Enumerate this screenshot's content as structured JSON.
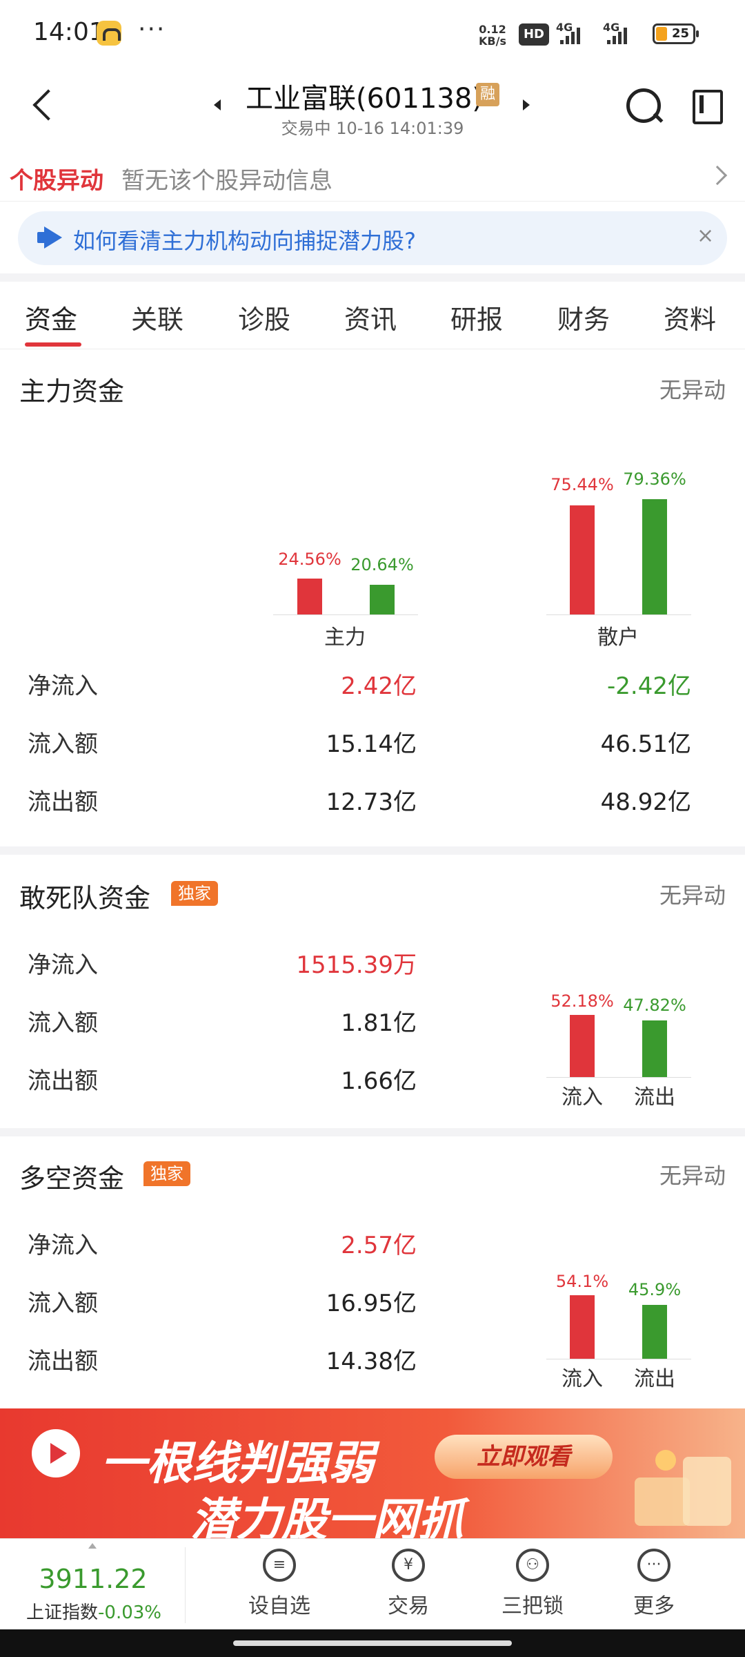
{
  "status_bar": {
    "time": "14:01",
    "dots": "···",
    "speed": "0.12\nKB/s",
    "hd": "HD",
    "net1": "4G",
    "net2": "4G",
    "battery": "25"
  },
  "header": {
    "stock_name": "工业富联(601138)",
    "rong_badge": "融",
    "trade_status": "交易中 10-16 14:01:39"
  },
  "alert": {
    "tag": "个股异动",
    "text": "暂无该个股异动信息"
  },
  "tip": {
    "text": "如何看清主力机构动向捕捉潜力股?",
    "close": "×"
  },
  "tabs": [
    "资金",
    "关联",
    "诊股",
    "资讯",
    "研报",
    "财务",
    "资料"
  ],
  "main_funds": {
    "title": "主力资金",
    "status": "无异动",
    "categories": [
      "主力",
      "散户"
    ],
    "inflow_pct": [
      "24.56%",
      "75.44%"
    ],
    "outflow_pct": [
      "20.64%",
      "79.36%"
    ],
    "rows": [
      {
        "label": "净流入",
        "main": "2.42亿",
        "retail": "-2.42亿"
      },
      {
        "label": "流入额",
        "main": "15.14亿",
        "retail": "46.51亿"
      },
      {
        "label": "流出额",
        "main": "12.73亿",
        "retail": "48.92亿"
      }
    ]
  },
  "dare_funds": {
    "title": "敢死队资金",
    "badge": "独家",
    "status": "无异动",
    "rows": [
      {
        "label": "净流入",
        "value": "1515.39万"
      },
      {
        "label": "流入额",
        "value": "1.81亿"
      },
      {
        "label": "流出额",
        "value": "1.66亿"
      }
    ],
    "inflow_pct": "52.18%",
    "outflow_pct": "47.82%",
    "inflow_label": "流入",
    "outflow_label": "流出"
  },
  "long_short_funds": {
    "title": "多空资金",
    "badge": "独家",
    "status": "无异动",
    "rows": [
      {
        "label": "净流入",
        "value": "2.57亿"
      },
      {
        "label": "流入额",
        "value": "16.95亿"
      },
      {
        "label": "流出额",
        "value": "14.38亿"
      }
    ],
    "inflow_pct": "54.1%",
    "outflow_pct": "45.9%",
    "inflow_label": "流入",
    "outflow_label": "流出"
  },
  "ad": {
    "line1": "一根线判强弱",
    "line2": "潜力股一网抓",
    "button": "立即观看"
  },
  "bottom": {
    "index_value": "3911.22",
    "index_name": "上证指数",
    "index_change": "-0.03%",
    "nav": [
      {
        "label": "设自选",
        "icon": "≡"
      },
      {
        "label": "交易",
        "icon": "¥"
      },
      {
        "label": "三把锁",
        "icon": "⚇"
      },
      {
        "label": "更多",
        "icon": "···"
      }
    ]
  },
  "colors": {
    "up_red": "#e0353b",
    "down_green": "#3a9a2e",
    "link_blue": "#2f6fd6",
    "badge_orange": "#f0742a"
  },
  "chart_data": [
    {
      "type": "bar",
      "categories": [
        "主力",
        "散户"
      ],
      "series": [
        {
          "values": [
            24.56,
            75.44
          ]
        },
        {
          "values": [
            20.64,
            79.36
          ]
        }
      ]
    },
    {
      "type": "bar",
      "categories": [
        "流入",
        "流出"
      ],
      "values": [
        52.18,
        47.82
      ]
    },
    {
      "type": "bar",
      "categories": [
        "流入",
        "流出"
      ],
      "values": [
        54.1,
        45.9
      ]
    }
  ]
}
